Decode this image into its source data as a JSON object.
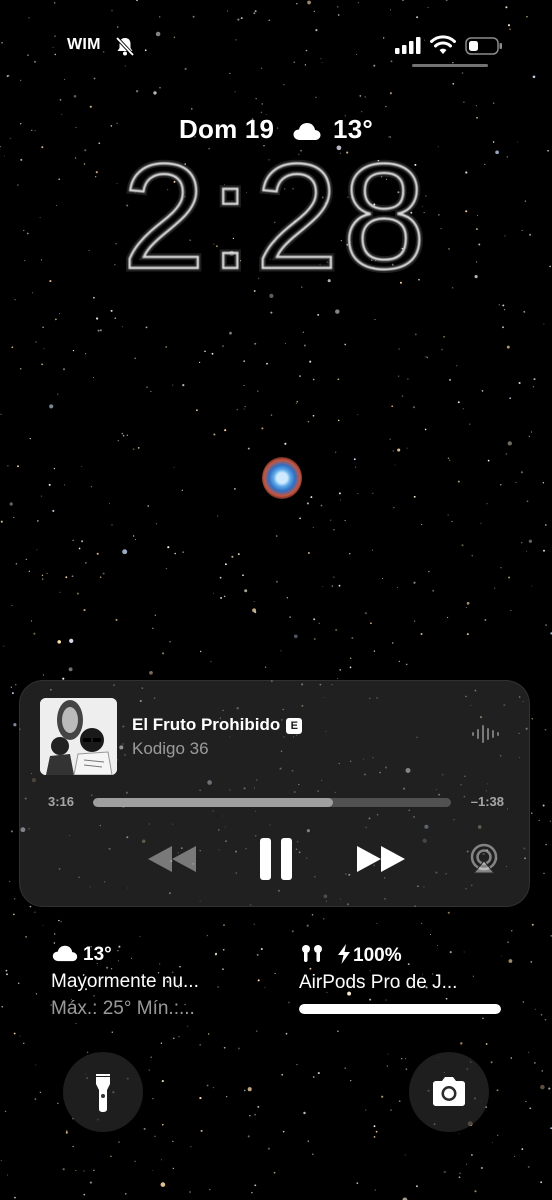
{
  "status_bar": {
    "carrier": "WIM",
    "icons": [
      "bell-slash-icon",
      "cellular-signal-icon",
      "wifi-icon",
      "battery-icon"
    ]
  },
  "lock_screen": {
    "date": "Dom 19",
    "weather_icon": "cloud-icon",
    "temperature": "13°",
    "time": "2:28"
  },
  "now_playing": {
    "title": "El Fruto Prohibido",
    "explicit_badge": "E",
    "artist": "Kodigo 36",
    "elapsed": "3:16",
    "remaining": "–1:38",
    "progress": 0.67,
    "controls": [
      "rewind-icon",
      "pause-icon",
      "fast-forward-icon",
      "airplay-icon"
    ]
  },
  "widgets": {
    "weather": {
      "icon": "cloud-icon",
      "temperature": "13°",
      "condition": "Mayormente nu...",
      "range": "Máx.: 25° Mín.:..."
    },
    "airpods": {
      "icon": "airpods-icon",
      "battery": "100%",
      "name": "AirPods Pro de J...",
      "battery_level": 1.0
    }
  },
  "quick_actions": {
    "left": "flashlight-icon",
    "right": "camera-icon"
  },
  "colors": {
    "background": "#000000",
    "player_bg": "#3a3a3c",
    "text_secondary": "#9a9a9a"
  }
}
